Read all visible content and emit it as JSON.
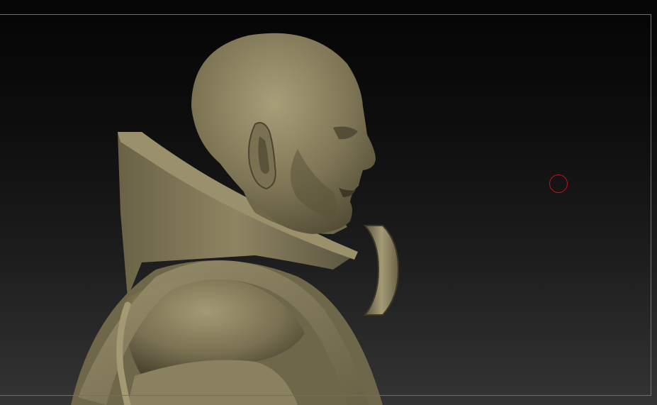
{
  "app": {
    "view": "3d-sculpt-viewport",
    "subject": "bald-male-bust-profile"
  },
  "colors": {
    "material": "#8a8060",
    "material_light": "#b0a680",
    "material_shadow": "#4a4430",
    "background_top": "#050505",
    "background_bottom": "#343434",
    "frame": "#6f6f6f",
    "brush": "#c0121e"
  },
  "icons": {
    "brush_cursor": "circle-brush-cursor-icon"
  }
}
